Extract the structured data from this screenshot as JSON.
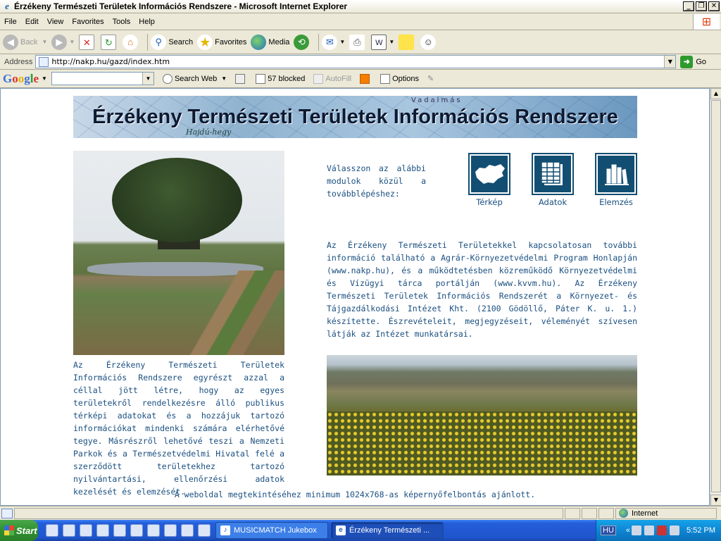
{
  "window": {
    "title": "Érzékeny Természeti Területek Információs Rendszere - Microsoft Internet Explorer",
    "minimize": "_",
    "maximize": "❐",
    "close": "✕"
  },
  "menu": [
    "File",
    "Edit",
    "View",
    "Favorites",
    "Tools",
    "Help"
  ],
  "toolbar": {
    "back": "Back",
    "search": "Search",
    "favorites": "Favorites",
    "media": "Media"
  },
  "address": {
    "label": "Address",
    "url": "http://nakp.hu/gazd/index.htm",
    "go": "Go"
  },
  "googlebar": {
    "logo": "Google",
    "search_web": "Search Web",
    "blocked": "57 blocked",
    "autofill": "AutoFill",
    "options": "Options"
  },
  "page": {
    "banner_title": "Érzékeny Természeti Területek Információs Rendszere",
    "banner_map_text_1": "Hajdú-hegy",
    "banner_map_text_2": "Vadalmás",
    "intro": "Az Érzékeny Természeti Területek Információs Rendszere egyrészt azzal a céllal jött létre, hogy az egyes területekről rendelkezésre álló publikus térképi adatokat és a hozzájuk tartozó információkat mindenki számára elérhetővé tegye. Másrészről lehetővé teszi a Nemzeti Parkok és a Természetvédelmi Hivatal felé a szerződött területekhez tartozó nyilvántartási, ellenőrzési adatok kezelését és elemzését.",
    "choose": "Válasszon az alábbi modulok közül a továbblépéshez:",
    "modules": [
      {
        "label": "Térkép",
        "icon": "hungary-map-icon"
      },
      {
        "label": "Adatok",
        "icon": "data-sheet-icon"
      },
      {
        "label": "Elemzés",
        "icon": "analysis-books-icon"
      }
    ],
    "description": "Az Érzékeny Természeti Területekkel kapcsolatosan további információ található a Agrár-Környezetvédelmi Program Honlapján (www.nakp.hu), és a működtetésben közreműködő Környezetvédelmi és Vízügyi tárca portálján (www.kvvm.hu). Az Érzékeny Természeti Területek Információs Rendszerét a Környezet- és Tájgazdálkodási Intézet Kht. (2100 Gödöllő, Páter K. u. 1.) készítette. Észrevételeit, megjegyzéseit, véleményét szívesen látják az Intézet munkatársai.",
    "footnote": "A weboldal megtekintéséhez minimum 1024x768-as képernyőfelbontás ajánlott."
  },
  "status": {
    "zone": "Internet"
  },
  "taskbar": {
    "start": "Start",
    "tasks": [
      {
        "label": "MUSICMATCH Jukebox",
        "active": false
      },
      {
        "label": "Érzékeny Természeti ...",
        "active": true
      }
    ],
    "lang": "HU",
    "tray_chevron": "«",
    "clock": "5:52 PM"
  }
}
